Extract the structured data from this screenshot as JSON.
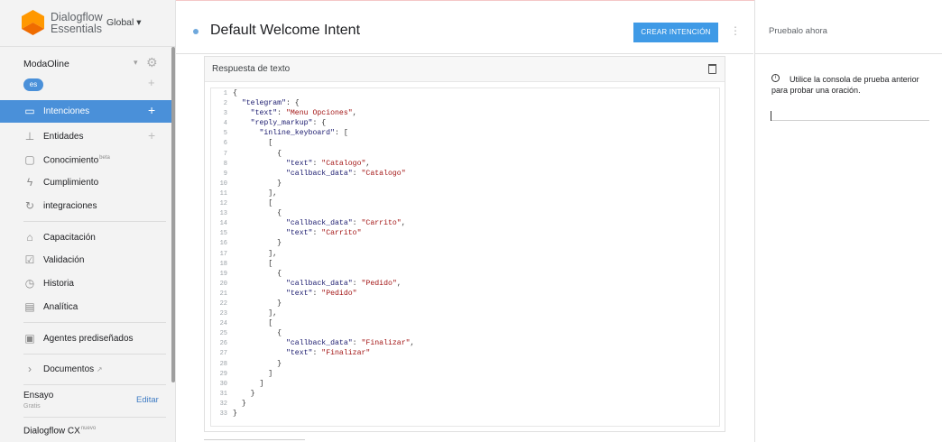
{
  "brand": {
    "line1": "Dialogflow",
    "line2": "Essentials",
    "region": "Global ▾"
  },
  "agent": {
    "name": "ModaOline",
    "caret": "▾",
    "language": "es"
  },
  "nav": {
    "intents": "Intenciones",
    "entities": "Entidades",
    "knowledge": "Conocimiento",
    "knowledge_badge": "beta",
    "fulfillment": "Cumplimiento",
    "integrations": "integraciones",
    "training": "Capacitación",
    "validation": "Validación",
    "history": "Historia",
    "analytics": "Analítica",
    "prebuilt": "Agentes prediseñados",
    "docs": "Documentos"
  },
  "plan": {
    "name": "Ensayo",
    "tier": "Gratis",
    "edit": "Editar"
  },
  "cx": {
    "label": "Dialogflow CX",
    "badge": "nuevo"
  },
  "header": {
    "title": "Default Welcome Intent",
    "create_button": "CREAR INTENCIÓN"
  },
  "response_card": {
    "title": "Respuesta de texto",
    "code_lines": [
      "{",
      "  \"telegram\": {",
      "    \"text\": \"Menu Opciones\",",
      "    \"reply_markup\": {",
      "      \"inline_keyboard\": [",
      "        [",
      "          {",
      "            \"text\": \"Catalogo\",",
      "            \"callback_data\": \"Catalogo\"",
      "          }",
      "        ],",
      "        [",
      "          {",
      "            \"callback_data\": \"Carrito\",",
      "            \"text\": \"Carrito\"",
      "          }",
      "        ],",
      "        [",
      "          {",
      "            \"callback_data\": \"Pedido\",",
      "            \"text\": \"Pedido\"",
      "          }",
      "        ],",
      "        [",
      "          {",
      "            \"callback_data\": \"Finalizar\",",
      "            \"text\": \"Finalizar\"",
      "          }",
      "        ]",
      "      ]",
      "    }",
      "  }",
      "}"
    ]
  },
  "test_panel": {
    "title": "Pruebalo ahora",
    "info_text": "Utilice la consola de prueba anterior para probar una oración.",
    "input_value": ""
  },
  "colors": {
    "accent": "#4a90d9",
    "button": "#3f9ae6",
    "sidebar_bg": "#f3f3f3",
    "string": "#a31515"
  }
}
